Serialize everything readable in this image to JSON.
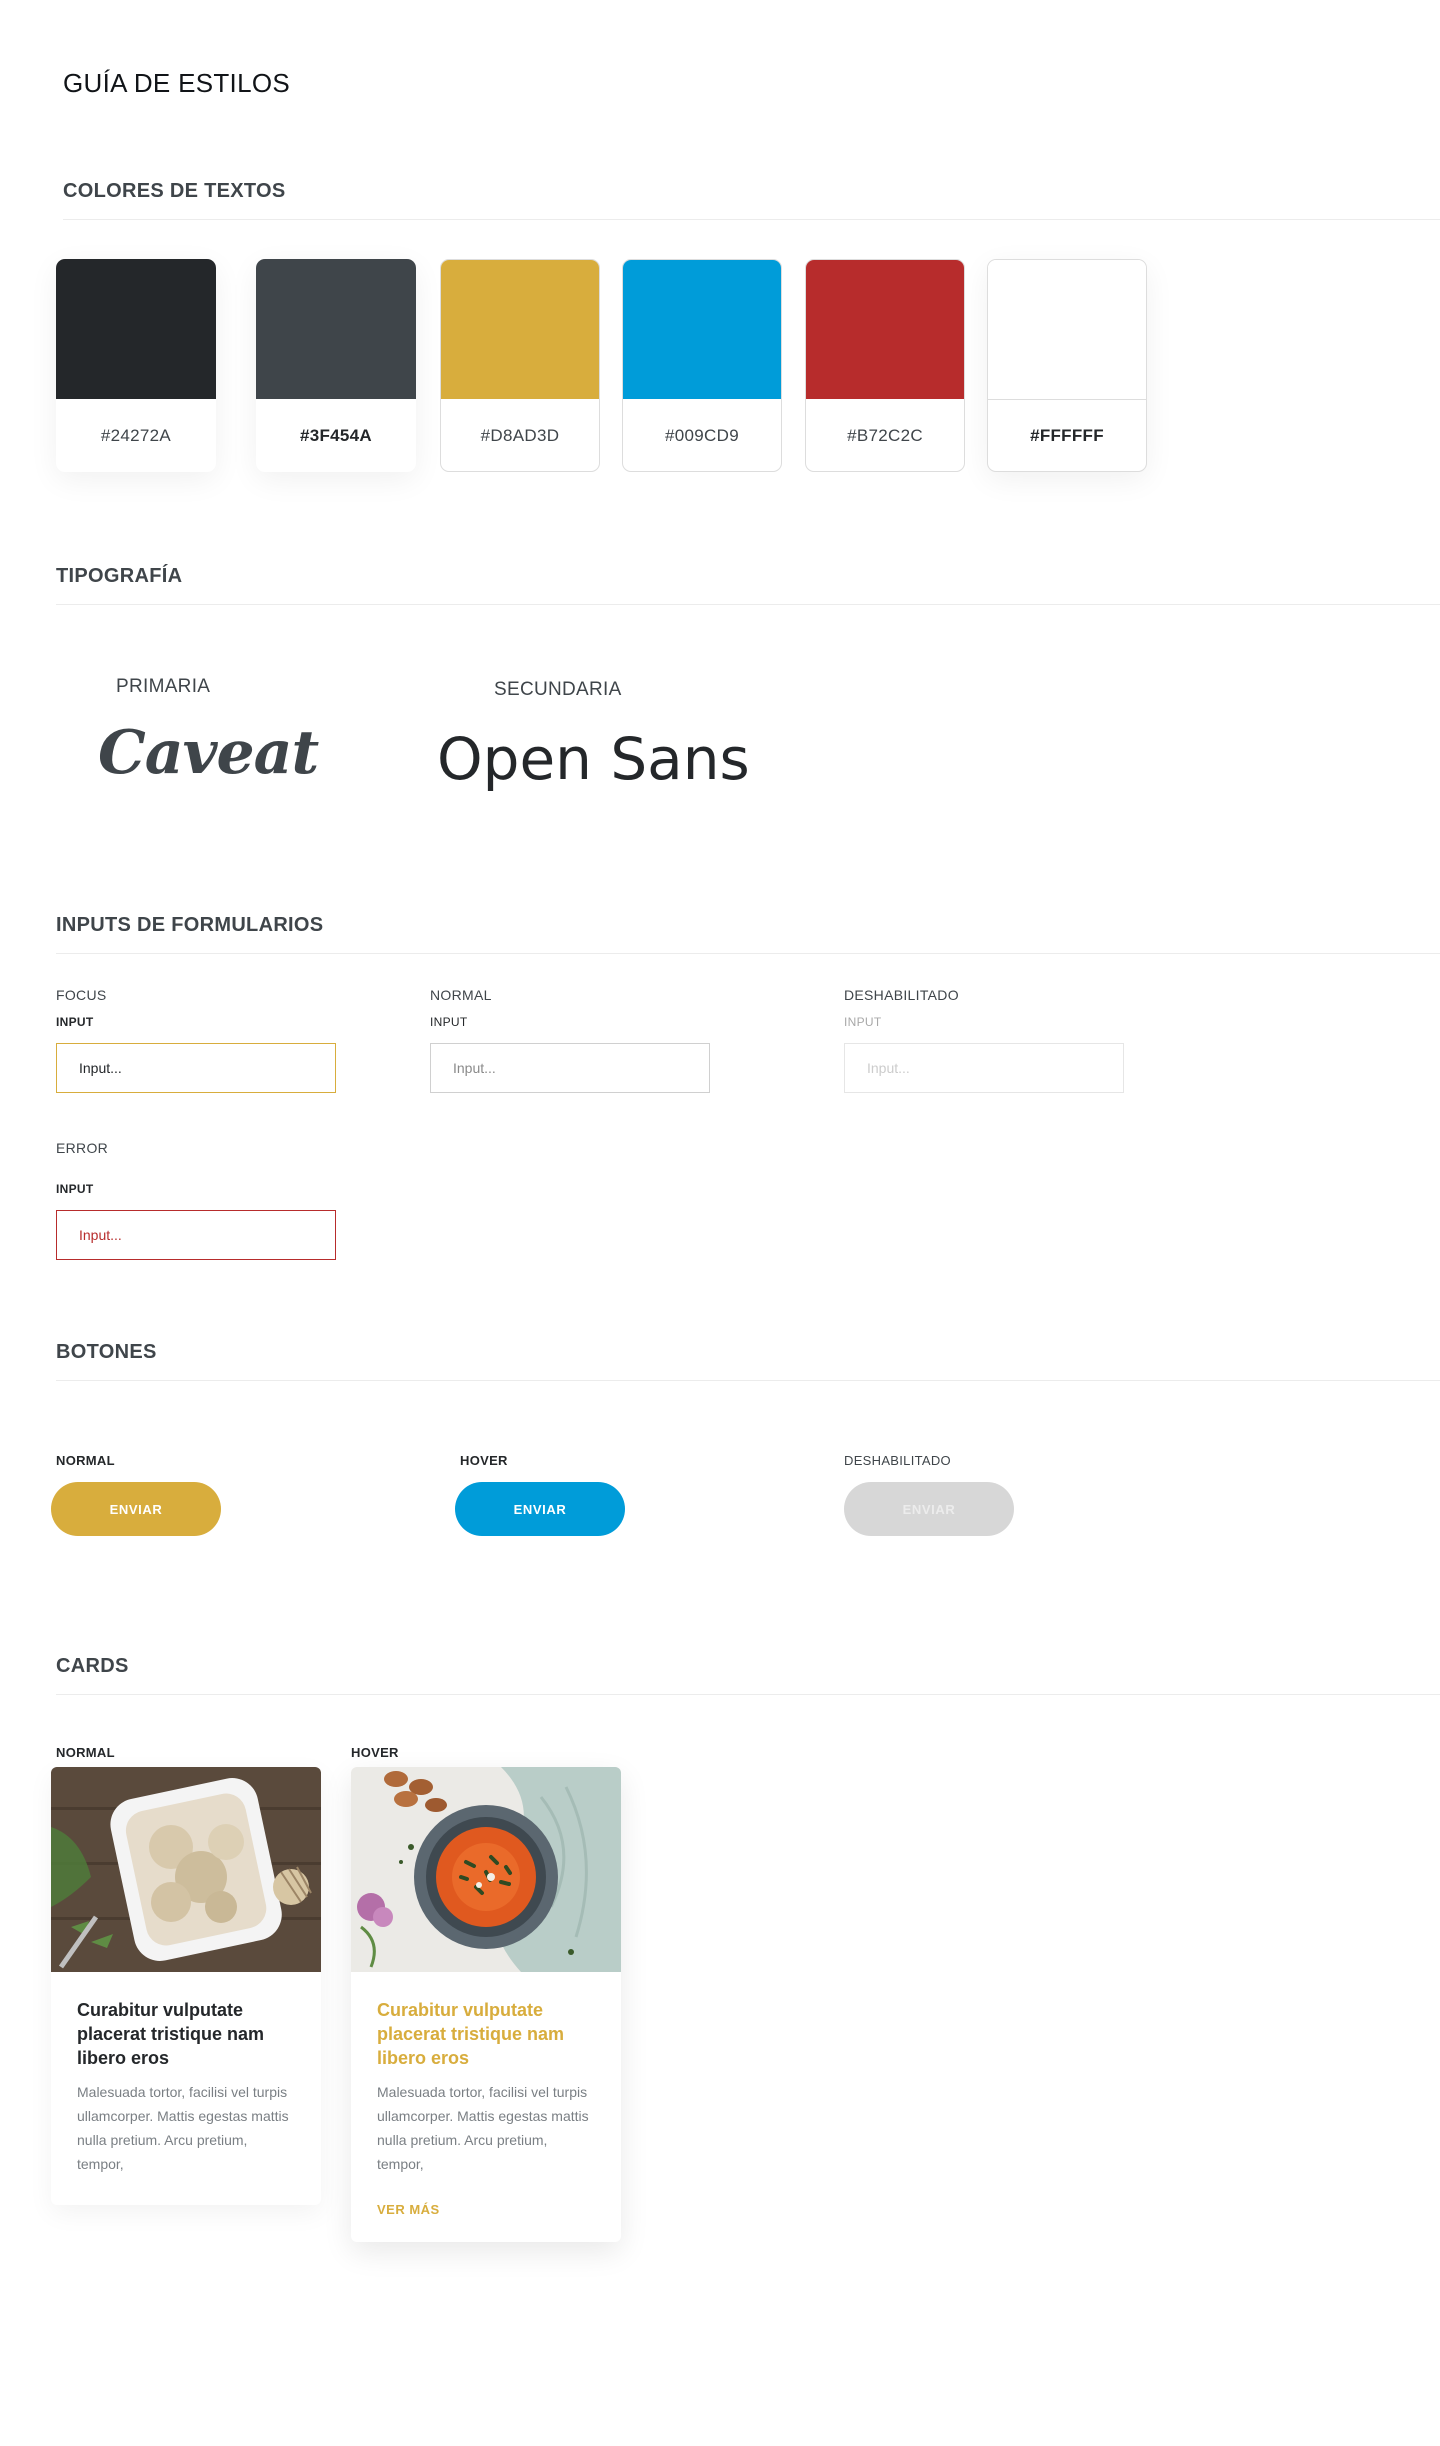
{
  "page": {
    "title": "GUÍA DE ESTILOS"
  },
  "colors": {
    "heading": "COLORES DE TEXTOS",
    "swatches": [
      {
        "hex": "#24272A",
        "label": "#24272A"
      },
      {
        "hex": "#3F454A",
        "label": "#3F454A"
      },
      {
        "hex": "#D8AD3D",
        "label": "#D8AD3D"
      },
      {
        "hex": "#009CD9",
        "label": "#009CD9"
      },
      {
        "hex": "#B72C2C",
        "label": "#B72C2C"
      },
      {
        "hex": "#FFFFFF",
        "label": "#FFFFFF"
      }
    ]
  },
  "typography": {
    "heading": "TIPOGRAFÍA",
    "primary_label": "PRIMARIA",
    "primary_font": "Caveat",
    "secondary_label": "SECUNDARIA",
    "secondary_font": "Open Sans"
  },
  "inputs": {
    "heading": "INPUTS DE FORMULARIOS",
    "focus": {
      "state": "FOCUS",
      "label": "INPUT",
      "placeholder": "Input..."
    },
    "normal": {
      "state": "NORMAL",
      "label": "INPUT",
      "placeholder": "Input..."
    },
    "disabled": {
      "state": "DESHABILITADO",
      "label": "INPUT",
      "placeholder": "Input..."
    },
    "error": {
      "state": "ERROR",
      "label": "INPUT",
      "placeholder": "Input..."
    }
  },
  "buttons": {
    "heading": "BOTONES",
    "normal": {
      "state": "NORMAL",
      "label": "ENVIAR"
    },
    "hover": {
      "state": "HOVER",
      "label": "ENVIAR"
    },
    "disabled": {
      "state": "DESHABILITADO",
      "label": "ENVIAR"
    }
  },
  "cards": {
    "heading": "CARDS",
    "normal": {
      "state": "NORMAL",
      "title": "Curabitur vulputate placerat tristique nam libero eros",
      "text": "Malesuada tortor, facilisi vel turpis ullamcorper. Mattis egestas mattis nulla pretium. Arcu pretium, tempor,"
    },
    "hover": {
      "state": "HOVER",
      "title": "Curabitur vulputate placerat tristique nam libero eros",
      "text": "Malesuada tortor, facilisi vel turpis ullamcorper. Mattis egestas mattis nulla pretium. Arcu pretium, tempor,",
      "link": "VER MÁS"
    }
  }
}
